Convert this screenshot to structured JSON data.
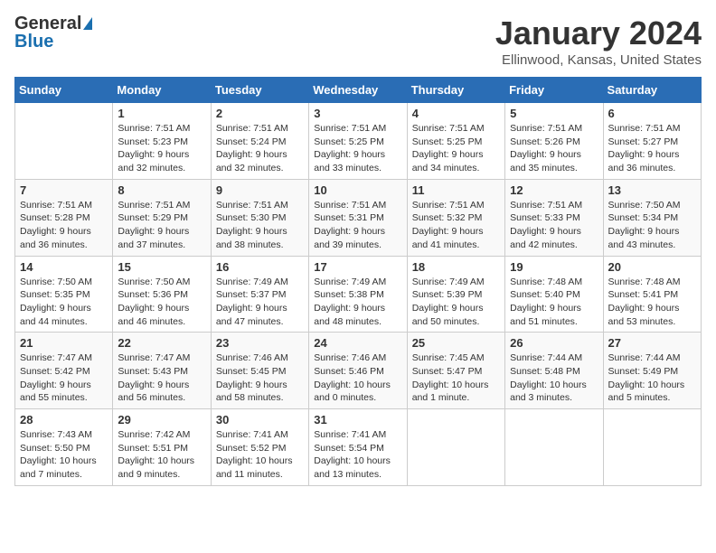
{
  "logo": {
    "general": "General",
    "blue": "Blue"
  },
  "title": {
    "month_year": "January 2024",
    "location": "Ellinwood, Kansas, United States"
  },
  "weekdays": [
    "Sunday",
    "Monday",
    "Tuesday",
    "Wednesday",
    "Thursday",
    "Friday",
    "Saturday"
  ],
  "weeks": [
    [
      {
        "day": "",
        "info": ""
      },
      {
        "day": "1",
        "info": "Sunrise: 7:51 AM\nSunset: 5:23 PM\nDaylight: 9 hours\nand 32 minutes."
      },
      {
        "day": "2",
        "info": "Sunrise: 7:51 AM\nSunset: 5:24 PM\nDaylight: 9 hours\nand 32 minutes."
      },
      {
        "day": "3",
        "info": "Sunrise: 7:51 AM\nSunset: 5:25 PM\nDaylight: 9 hours\nand 33 minutes."
      },
      {
        "day": "4",
        "info": "Sunrise: 7:51 AM\nSunset: 5:25 PM\nDaylight: 9 hours\nand 34 minutes."
      },
      {
        "day": "5",
        "info": "Sunrise: 7:51 AM\nSunset: 5:26 PM\nDaylight: 9 hours\nand 35 minutes."
      },
      {
        "day": "6",
        "info": "Sunrise: 7:51 AM\nSunset: 5:27 PM\nDaylight: 9 hours\nand 36 minutes."
      }
    ],
    [
      {
        "day": "7",
        "info": "Sunrise: 7:51 AM\nSunset: 5:28 PM\nDaylight: 9 hours\nand 36 minutes."
      },
      {
        "day": "8",
        "info": "Sunrise: 7:51 AM\nSunset: 5:29 PM\nDaylight: 9 hours\nand 37 minutes."
      },
      {
        "day": "9",
        "info": "Sunrise: 7:51 AM\nSunset: 5:30 PM\nDaylight: 9 hours\nand 38 minutes."
      },
      {
        "day": "10",
        "info": "Sunrise: 7:51 AM\nSunset: 5:31 PM\nDaylight: 9 hours\nand 39 minutes."
      },
      {
        "day": "11",
        "info": "Sunrise: 7:51 AM\nSunset: 5:32 PM\nDaylight: 9 hours\nand 41 minutes."
      },
      {
        "day": "12",
        "info": "Sunrise: 7:51 AM\nSunset: 5:33 PM\nDaylight: 9 hours\nand 42 minutes."
      },
      {
        "day": "13",
        "info": "Sunrise: 7:50 AM\nSunset: 5:34 PM\nDaylight: 9 hours\nand 43 minutes."
      }
    ],
    [
      {
        "day": "14",
        "info": "Sunrise: 7:50 AM\nSunset: 5:35 PM\nDaylight: 9 hours\nand 44 minutes."
      },
      {
        "day": "15",
        "info": "Sunrise: 7:50 AM\nSunset: 5:36 PM\nDaylight: 9 hours\nand 46 minutes."
      },
      {
        "day": "16",
        "info": "Sunrise: 7:49 AM\nSunset: 5:37 PM\nDaylight: 9 hours\nand 47 minutes."
      },
      {
        "day": "17",
        "info": "Sunrise: 7:49 AM\nSunset: 5:38 PM\nDaylight: 9 hours\nand 48 minutes."
      },
      {
        "day": "18",
        "info": "Sunrise: 7:49 AM\nSunset: 5:39 PM\nDaylight: 9 hours\nand 50 minutes."
      },
      {
        "day": "19",
        "info": "Sunrise: 7:48 AM\nSunset: 5:40 PM\nDaylight: 9 hours\nand 51 minutes."
      },
      {
        "day": "20",
        "info": "Sunrise: 7:48 AM\nSunset: 5:41 PM\nDaylight: 9 hours\nand 53 minutes."
      }
    ],
    [
      {
        "day": "21",
        "info": "Sunrise: 7:47 AM\nSunset: 5:42 PM\nDaylight: 9 hours\nand 55 minutes."
      },
      {
        "day": "22",
        "info": "Sunrise: 7:47 AM\nSunset: 5:43 PM\nDaylight: 9 hours\nand 56 minutes."
      },
      {
        "day": "23",
        "info": "Sunrise: 7:46 AM\nSunset: 5:45 PM\nDaylight: 9 hours\nand 58 minutes."
      },
      {
        "day": "24",
        "info": "Sunrise: 7:46 AM\nSunset: 5:46 PM\nDaylight: 10 hours\nand 0 minutes."
      },
      {
        "day": "25",
        "info": "Sunrise: 7:45 AM\nSunset: 5:47 PM\nDaylight: 10 hours\nand 1 minute."
      },
      {
        "day": "26",
        "info": "Sunrise: 7:44 AM\nSunset: 5:48 PM\nDaylight: 10 hours\nand 3 minutes."
      },
      {
        "day": "27",
        "info": "Sunrise: 7:44 AM\nSunset: 5:49 PM\nDaylight: 10 hours\nand 5 minutes."
      }
    ],
    [
      {
        "day": "28",
        "info": "Sunrise: 7:43 AM\nSunset: 5:50 PM\nDaylight: 10 hours\nand 7 minutes."
      },
      {
        "day": "29",
        "info": "Sunrise: 7:42 AM\nSunset: 5:51 PM\nDaylight: 10 hours\nand 9 minutes."
      },
      {
        "day": "30",
        "info": "Sunrise: 7:41 AM\nSunset: 5:52 PM\nDaylight: 10 hours\nand 11 minutes."
      },
      {
        "day": "31",
        "info": "Sunrise: 7:41 AM\nSunset: 5:54 PM\nDaylight: 10 hours\nand 13 minutes."
      },
      {
        "day": "",
        "info": ""
      },
      {
        "day": "",
        "info": ""
      },
      {
        "day": "",
        "info": ""
      }
    ]
  ]
}
